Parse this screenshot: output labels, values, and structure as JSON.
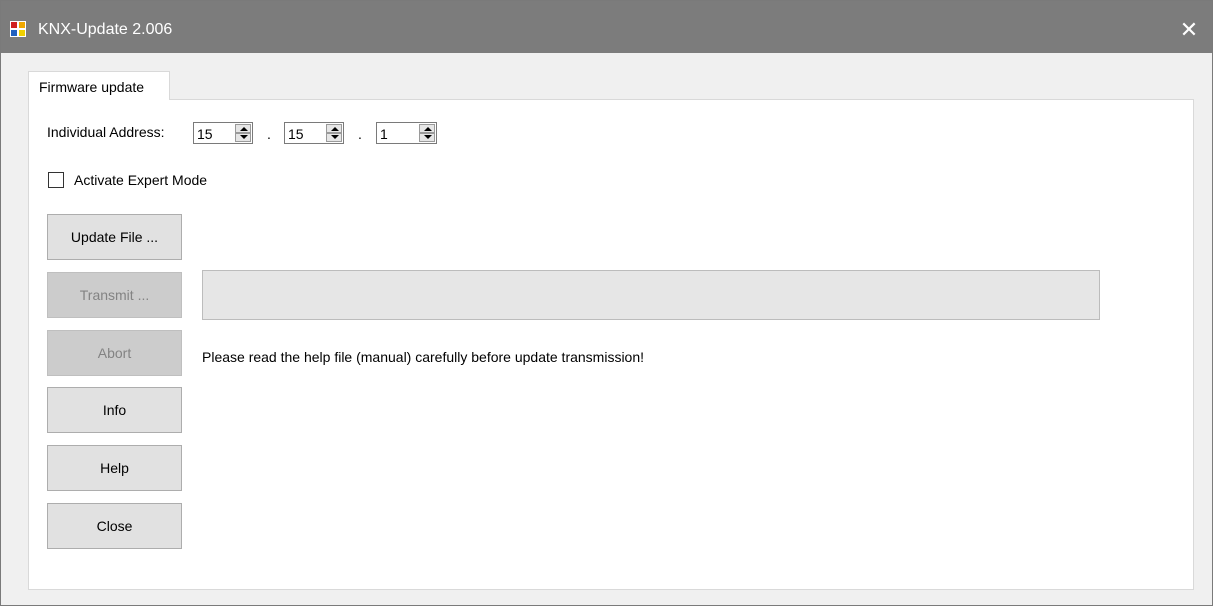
{
  "window": {
    "title": "KNX-Update 2.006",
    "app_icon": "knx-app-icon",
    "close_glyph": "✕"
  },
  "tabs": [
    {
      "label": "Firmware update",
      "selected": true
    }
  ],
  "address": {
    "label": "Individual Address:",
    "area": "15",
    "line": "15",
    "device": "1",
    "separator": "."
  },
  "expert_mode": {
    "label": "Activate Expert Mode",
    "checked": false
  },
  "buttons": {
    "update_file": "Update File ...",
    "transmit": "Transmit ...",
    "abort": "Abort",
    "info": "Info",
    "help": "Help",
    "close": "Close"
  },
  "progress": {
    "value": 0
  },
  "message": "Please read the help file (manual) carefully before update transmission!",
  "colors": {
    "titlebar": "#7c7c7c",
    "progress_fill": "#06b025"
  }
}
